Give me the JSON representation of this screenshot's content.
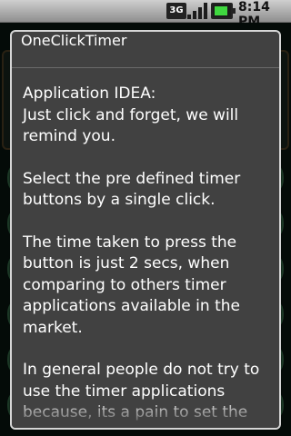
{
  "status_bar": {
    "network_label": "3G",
    "clock": "8:14 PM",
    "icons": [
      "network-3g-icon",
      "signal-strength-icon",
      "battery-charging-icon"
    ]
  },
  "dialog": {
    "title": "OneClickTimer",
    "paragraphs": [
      "Application IDEA:\nJust click and forget, we will remind you.",
      "Select the pre defined timer buttons by a single click.",
      "The time taken to press the button is just 2 secs, when comparing to others timer applications available in the market.",
      "In general people do not try to use the timer applications because, its a pain to set the"
    ]
  },
  "colors": {
    "dialog_bg": "#414141",
    "dialog_border": "#d6d6d6",
    "text": "#ffffff",
    "statusbar_bg": "#b0b0b0"
  }
}
